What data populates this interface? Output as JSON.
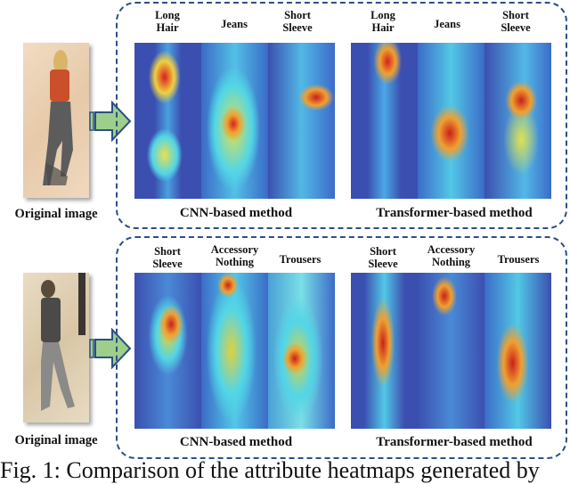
{
  "figure": {
    "rows": [
      {
        "original_label": "Original image",
        "subject": "woman-with-long-hair",
        "groups": [
          {
            "method": "CNN-based method",
            "attributes": [
              "Long\nHair",
              "Jeans",
              "Short\nSleeve"
            ]
          },
          {
            "method": "Transformer-based method",
            "attributes": [
              "Long\nHair",
              "Jeans",
              "Short\nSleeve"
            ]
          }
        ]
      },
      {
        "original_label": "Original image",
        "subject": "man-walking",
        "groups": [
          {
            "method": "CNN-based method",
            "attributes": [
              "Short\nSleeve",
              "Accessory\nNothing",
              "Trousers"
            ]
          },
          {
            "method": "Transformer-based method",
            "attributes": [
              "Short\nSleeve",
              "Accessory\nNothing",
              "Trousers"
            ]
          }
        ]
      }
    ],
    "caption": "Fig. 1: Comparison of the attribute heatmaps generated by",
    "colors": {
      "box_border": "#2c4f86",
      "arrow_fill": "#9dcf8a",
      "arrow_stroke": "#2c4f86",
      "heat_low": "#3b4fb0",
      "heat_mid": "#52d6e6",
      "heat_high": "#d6221c"
    }
  }
}
